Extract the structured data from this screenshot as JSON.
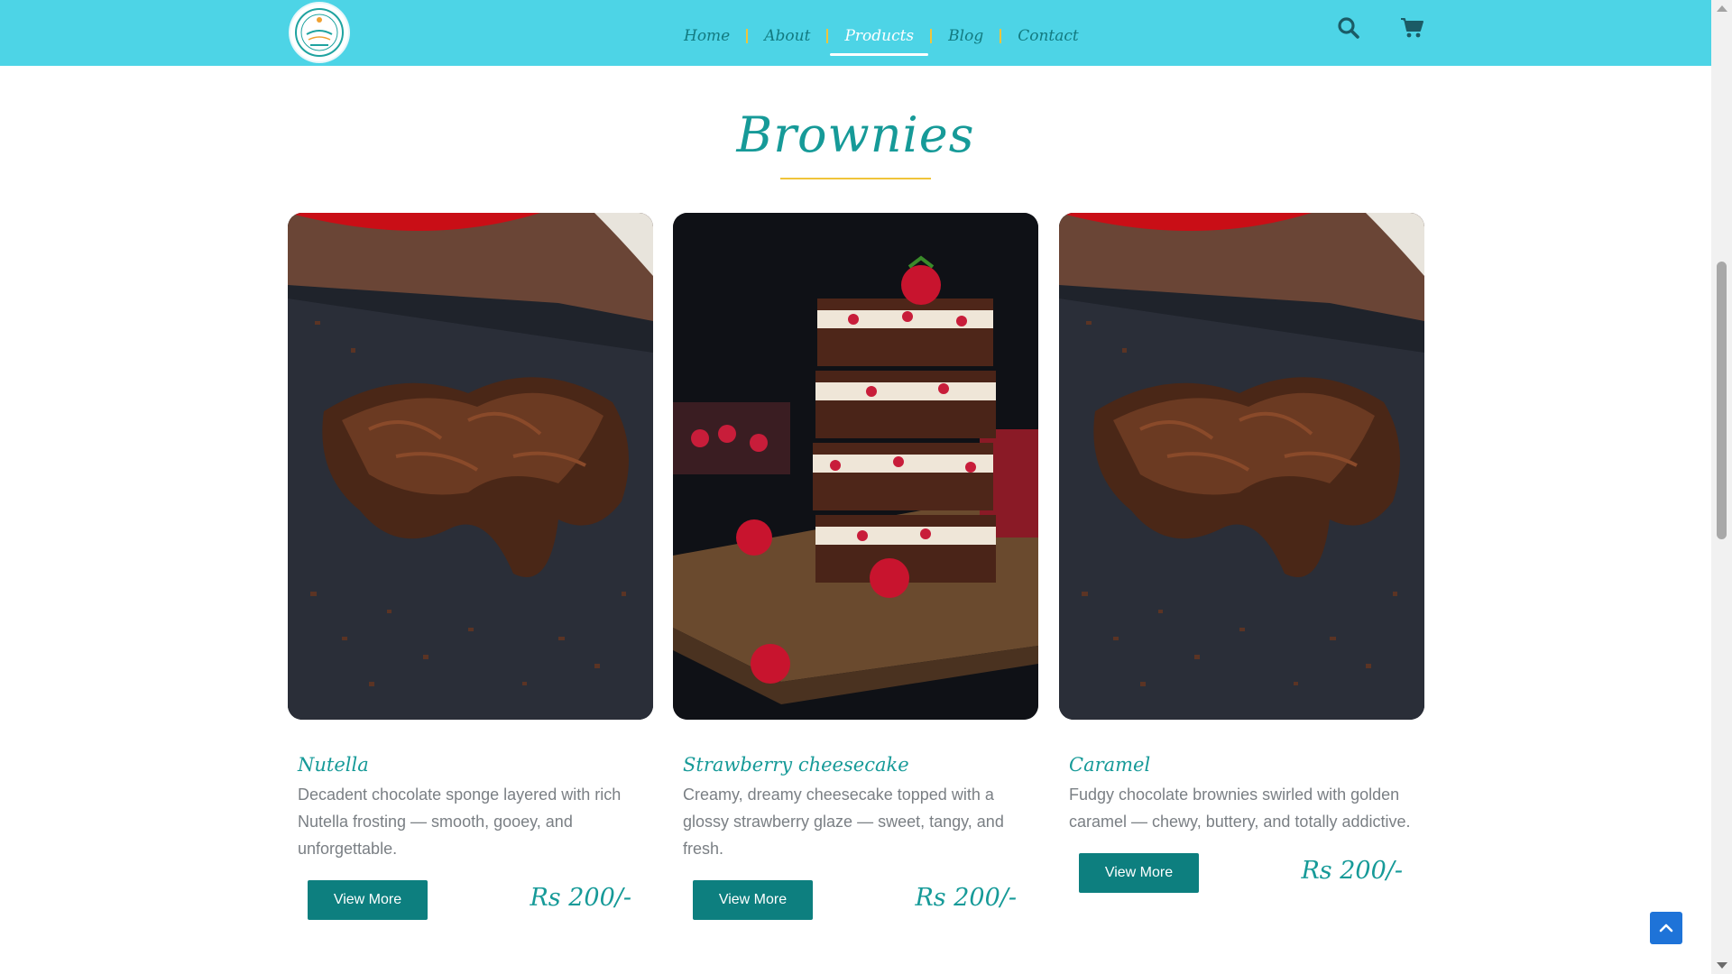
{
  "header": {
    "logo_icon": "cake-logo-icon",
    "nav": [
      {
        "label": "Home",
        "active": false
      },
      {
        "label": "About",
        "active": false
      },
      {
        "label": "Products",
        "active": true
      },
      {
        "label": "Blog",
        "active": false
      },
      {
        "label": "Contact",
        "active": false
      }
    ],
    "icons": [
      "search-icon",
      "cart-icon"
    ]
  },
  "section": {
    "title": "Brownies"
  },
  "products": [
    {
      "name": "Nutella",
      "description": "Decadent chocolate sponge layered with rich Nutella frosting — smooth, gooey, and unforgettable.",
      "button": "View More",
      "price": "Rs 200/-",
      "image": "chocolate-brownie-photo"
    },
    {
      "name": "Strawberry cheesecake",
      "description": "Creamy, dreamy cheesecake topped with a glossy strawberry glaze — sweet, tangy, and fresh.",
      "button": "View More",
      "price": "Rs 200/-",
      "image": "strawberry-brownie-stack-photo"
    },
    {
      "name": "Caramel",
      "description": "Fudgy chocolate brownies swirled with golden caramel — chewy, buttery, and totally addictive.",
      "button": "View More",
      "price": "Rs 200/-",
      "image": "chocolate-brownie-photo"
    }
  ],
  "colors": {
    "header_bg": "#4dd4e6",
    "teal": "#169a98",
    "button": "#0d7f7f",
    "accent_yellow": "#f0c43a"
  }
}
